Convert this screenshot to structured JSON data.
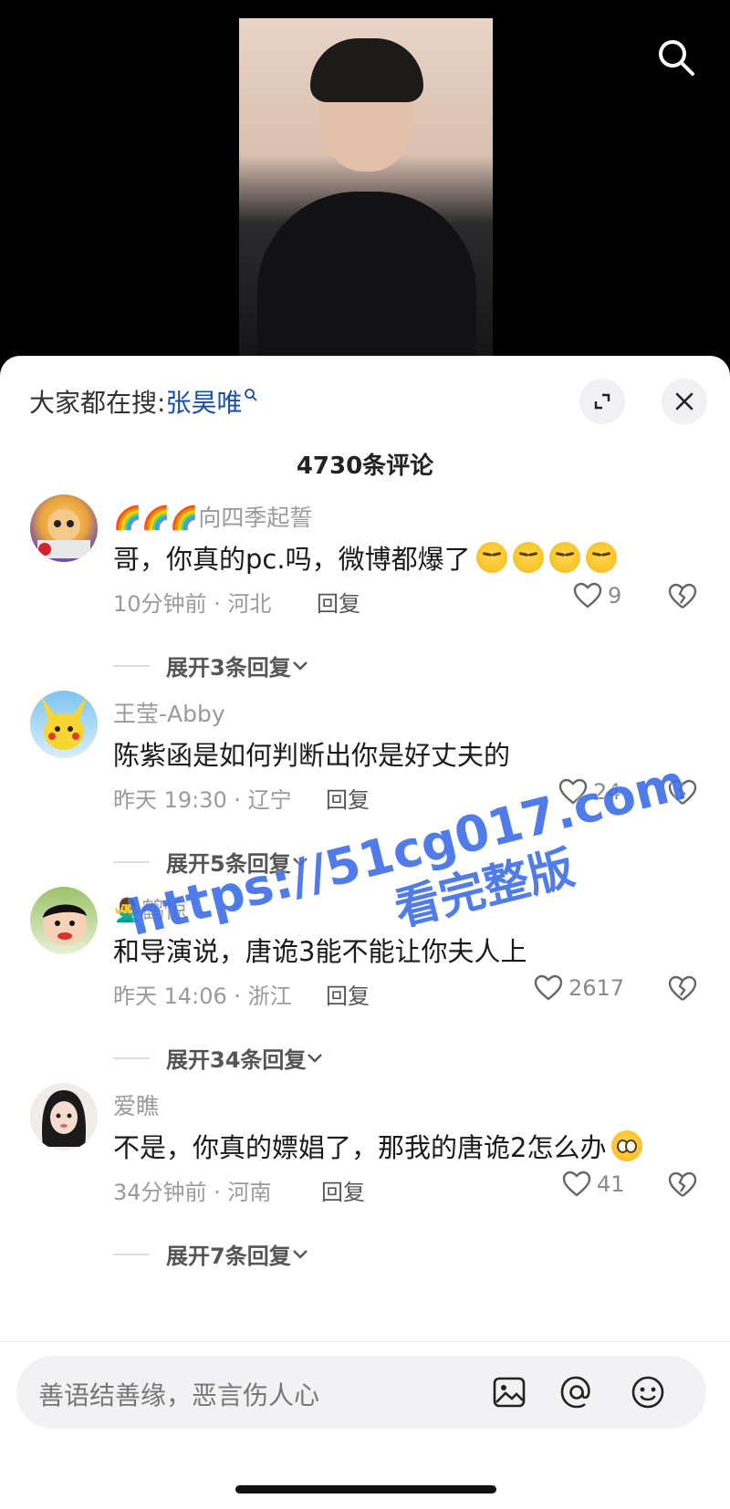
{
  "header": {
    "trending_prefix": "大家都在搜:",
    "trending_keyword": "张昊唯"
  },
  "comments_title": "4730条评论",
  "comments": [
    {
      "name": "🌈🌈🌈向四季起誓",
      "text": "哥，你真的pc.吗，微博都爆了",
      "time_location": "10分钟前 · 河北",
      "reply_label": "回复",
      "likes": "9",
      "expand_label": "展开3条回复"
    },
    {
      "name": "王莹-Abby",
      "text": "陈紫函是如何判断出你是好丈夫的",
      "time_location": "昨天 19:30 · 辽宁",
      "reply_label": "回复",
      "likes": "24",
      "expand_label": "展开5条回复"
    },
    {
      "name": "🙅‍♂️鹤惊",
      "text": "和导演说，唐诡3能不能让你夫人上",
      "time_location": "昨天 14:06 · 浙江",
      "reply_label": "回复",
      "likes": "2617",
      "expand_label": "展开34条回复"
    },
    {
      "name": "爱瞧",
      "text": "不是，你真的嫖娼了，那我的唐诡2怎么办",
      "time_location": "34分钟前 · 河南",
      "reply_label": "回复",
      "likes": "41",
      "expand_label": "展开7条回复"
    }
  ],
  "input": {
    "placeholder": "善语结善缘，恶言伤人心"
  },
  "watermark": {
    "line1": "https://51cg017.com",
    "line2": "看完整版"
  },
  "colors": {
    "keyword": "#1a4fa0",
    "watermark": "#3d6ee8"
  }
}
